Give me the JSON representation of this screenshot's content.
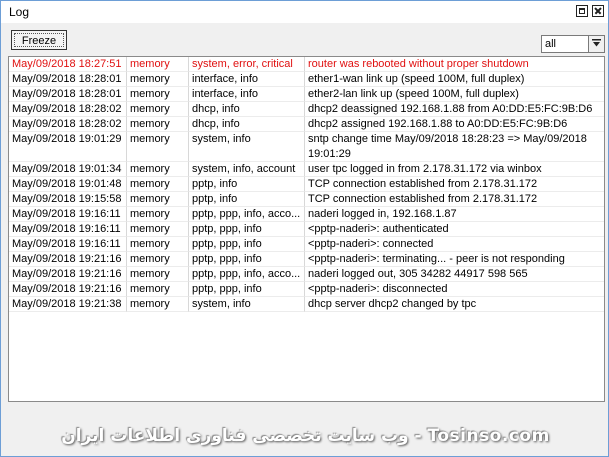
{
  "window": {
    "title": "Log"
  },
  "toolbar": {
    "freeze_label": "Freeze",
    "filter_value": "all"
  },
  "log_rows": [
    {
      "time": "May/09/2018 18:27:51",
      "buffer": "memory",
      "topics": "system, error, critical",
      "message": "router was rebooted without proper shutdown",
      "severity": "critical"
    },
    {
      "time": "May/09/2018 18:28:01",
      "buffer": "memory",
      "topics": "interface, info",
      "message": "ether1-wan link up (speed 100M, full duplex)"
    },
    {
      "time": "May/09/2018 18:28:01",
      "buffer": "memory",
      "topics": "interface, info",
      "message": "ether2-lan link up (speed 100M, full duplex)"
    },
    {
      "time": "May/09/2018 18:28:02",
      "buffer": "memory",
      "topics": "dhcp, info",
      "message": "dhcp2 deassigned 192.168.1.88 from A0:DD:E5:FC:9B:D6"
    },
    {
      "time": "May/09/2018 18:28:02",
      "buffer": "memory",
      "topics": "dhcp, info",
      "message": "dhcp2 assigned 192.168.1.88 to A0:DD:E5:FC:9B:D6"
    },
    {
      "time": "May/09/2018 19:01:29",
      "buffer": "memory",
      "topics": "system, info",
      "message": "sntp change time May/09/2018 18:28:23 => May/09/2018 19:01:29"
    },
    {
      "time": "May/09/2018 19:01:34",
      "buffer": "memory",
      "topics": "system, info, account",
      "message": "user tpc logged in from 2.178.31.172 via winbox"
    },
    {
      "time": "May/09/2018 19:01:48",
      "buffer": "memory",
      "topics": "pptp, info",
      "message": "TCP connection established from 2.178.31.172"
    },
    {
      "time": "May/09/2018 19:15:58",
      "buffer": "memory",
      "topics": "pptp, info",
      "message": "TCP connection established from 2.178.31.172"
    },
    {
      "time": "May/09/2018 19:16:11",
      "buffer": "memory",
      "topics": "pptp, ppp, info, acco...",
      "message": "naderi logged in, 192.168.1.87"
    },
    {
      "time": "May/09/2018 19:16:11",
      "buffer": "memory",
      "topics": "pptp, ppp, info",
      "message": "<pptp-naderi>: authenticated"
    },
    {
      "time": "May/09/2018 19:16:11",
      "buffer": "memory",
      "topics": "pptp, ppp, info",
      "message": "<pptp-naderi>: connected"
    },
    {
      "time": "May/09/2018 19:21:16",
      "buffer": "memory",
      "topics": "pptp, ppp, info",
      "message": "<pptp-naderi>: terminating... - peer is not responding"
    },
    {
      "time": "May/09/2018 19:21:16",
      "buffer": "memory",
      "topics": "pptp, ppp, info, acco...",
      "message": "naderi logged out, 305 34282 44917 598 565"
    },
    {
      "time": "May/09/2018 19:21:16",
      "buffer": "memory",
      "topics": "pptp, ppp, info",
      "message": "<pptp-naderi>: disconnected"
    },
    {
      "time": "May/09/2018 19:21:38",
      "buffer": "memory",
      "topics": "system, info",
      "message": "dhcp server dhcp2 changed by tpc"
    }
  ],
  "watermark": "وب سایت تخصصی فناوری اطلاعات ایران - Tosinso.com",
  "colors": {
    "alert": "#e01010",
    "border": "#6d9ed6"
  }
}
